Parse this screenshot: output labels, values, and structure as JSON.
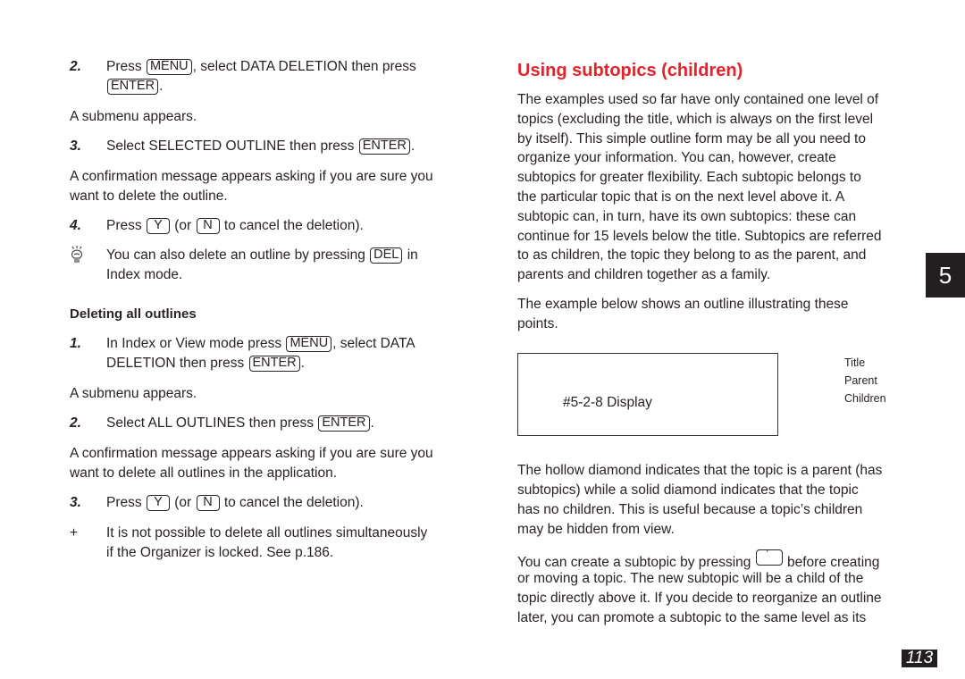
{
  "left": {
    "step2a": {
      "number": "2.",
      "part1": "Press",
      "key1": "MENU",
      "part2": ", select DATA DELETION then press",
      "key2": "ENTER",
      "part3": "."
    },
    "submenu1": "A submenu appears.",
    "step3a": {
      "number": "3.",
      "part1": "Select SELECTED OUTLINE then press",
      "key1": "ENTER",
      "part2": "."
    },
    "confirm1": {
      "line1": "A confirmation message appears asking if you are sure you",
      "line2": "want to delete the outline."
    },
    "step4a": {
      "number": "4.",
      "part1": "Press",
      "key1": "Y",
      "part2": "(or",
      "key2": "N",
      "part3": "to cancel the deletion)."
    },
    "tip": {
      "icon": "lightbulb-icon",
      "part1": "You can also delete an outline by pressing",
      "key1": "DEL",
      "part2": "in",
      "line2": "Index mode."
    },
    "section_heading": "Deleting all outlines",
    "step1b": {
      "number": "1.",
      "part1": "In Index or View mode press",
      "key1": "MENU",
      "part2": ", select DATA",
      "part3": "DELETION then press",
      "key2": "ENTER",
      "part4": "."
    },
    "submenu2": "A submenu appears.",
    "step2b": {
      "number": "2.",
      "part1": "Select ALL OUTLINES then press",
      "key1": "ENTER",
      "part2": "."
    },
    "confirm2": {
      "line1": "A confirmation message appears asking if you are sure you",
      "line2": "want to delete all outlines in the application."
    },
    "step3b": {
      "number": "3.",
      "part1": "Press",
      "key1": "Y",
      "part2": "(or",
      "key2": "N",
      "part3": "to cancel the deletion)."
    },
    "note": {
      "symbol": "+",
      "line1": "It is not possible to delete all outlines simultaneously",
      "line2": "if the Organizer is locked. See p.186."
    }
  },
  "right": {
    "title": "Using subtopics (children)",
    "para1": [
      "The examples used so far have only contained one level of",
      "topics (excluding the title, which is always on the first level",
      "by itself). This simple outline form may be all you need to",
      "organize your information. You can, however, create",
      "subtopics for greater flexibility. Each subtopic belongs to",
      "the particular topic that is on the next level above it. A",
      "subtopic can, in turn, have its own subtopics: these can",
      "continue for 15 levels below the title. Subtopics are referred",
      "to as children, the topic they belong to as the parent, and",
      "parents and children together as a family."
    ],
    "para2": [
      "The example below shows an outline illustrating these",
      "points."
    ],
    "display_label": "#5-2-8 Display",
    "legend": [
      "Title",
      "Parent",
      "Children"
    ],
    "para3": [
      "The hollow diamond indicates that the topic is a parent (has",
      "subtopics) while a solid diamond indicates that the topic",
      "has no children. This is useful because a topic’s children",
      "may be hidden from view."
    ],
    "para4": {
      "line1a": "You can create a subtopic by pressing",
      "line1b": "before creating",
      "lines": [
        "or moving a topic. The new subtopic will be a child of the",
        "topic directly above it. If you decide to reorganize an outline",
        "later, you can promote a subtopic to the same level as its"
      ]
    }
  },
  "chapter_tab": "5",
  "page_number": "113",
  "colors": {
    "title_red": "#e5232b",
    "text": "#2a2224",
    "tab_bg": "#231f20"
  }
}
